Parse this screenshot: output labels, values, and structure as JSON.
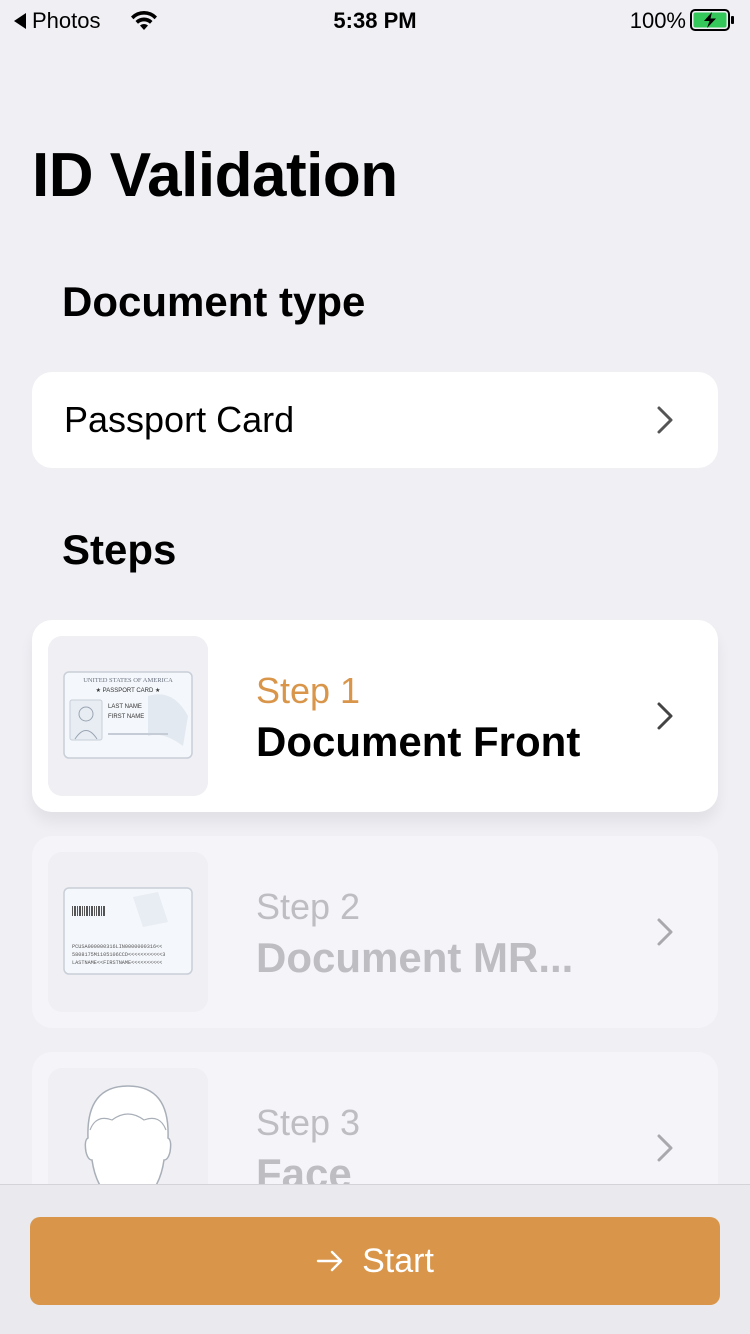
{
  "status_bar": {
    "back_label": "Photos",
    "time": "5:38 PM",
    "battery": "100%",
    "battery_color": "#34c759"
  },
  "page": {
    "title": "ID Validation"
  },
  "document_type": {
    "heading": "Document type",
    "value": "Passport Card"
  },
  "steps": {
    "heading": "Steps",
    "items": [
      {
        "number": "Step 1",
        "name": "Document Front",
        "thumb_icon": "passport-card-front-icon",
        "state": "active"
      },
      {
        "number": "Step 2",
        "name": "Document MR...",
        "thumb_icon": "passport-card-mrz-icon",
        "state": "inactive"
      },
      {
        "number": "Step 3",
        "name": "Face",
        "thumb_icon": "face-silhouette-icon",
        "state": "inactive"
      }
    ]
  },
  "card_front": {
    "country": "UNITED STATES OF AMERICA",
    "type": "★ PASSPORT CARD ★",
    "last_name": "LAST NAME",
    "first_name": "FIRST NAME"
  },
  "card_mrz": {
    "line1": "PCUSA000000316LIN0000000316<<",
    "line2": "5808175M1105106CCD<<<<<<<<<<<3",
    "line3": "LASTNAME<<FIRSTNAME<<<<<<<<<<"
  },
  "start_button": {
    "label": "Start",
    "icon": "arrow-right-icon"
  },
  "colors": {
    "accent": "#d9964a",
    "background": "#efeff4",
    "muted": "#bdbdc2"
  }
}
